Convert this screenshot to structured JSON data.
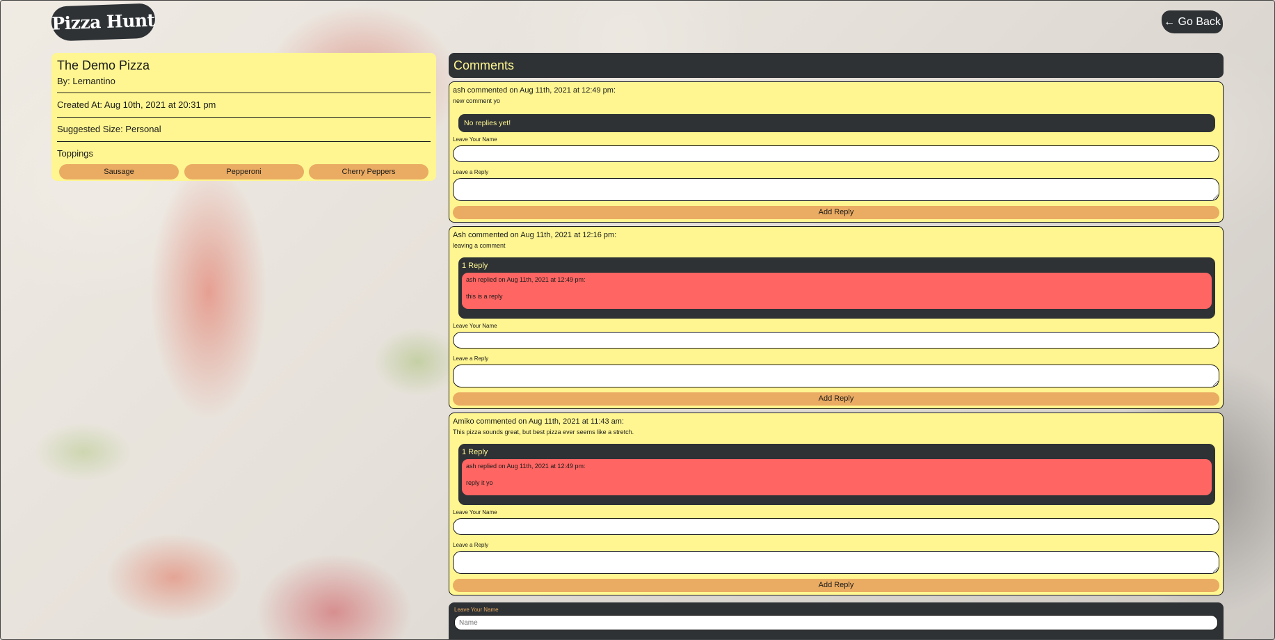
{
  "app": {
    "logo": "Pizza Hunt",
    "back_button": "← Go Back"
  },
  "pizza": {
    "name": "The Demo Pizza",
    "by": "By: Lernantino",
    "created": "Created At: Aug 10th, 2021 at 20:31 pm",
    "size": "Suggested Size: Personal",
    "toppings_label": "Toppings",
    "toppings": [
      "Sausage",
      "Pepperoni",
      "Cherry Peppers"
    ]
  },
  "comments": {
    "header": "Comments",
    "items": [
      {
        "head": "ash commented on Aug 11th, 2021 at 12:49 pm:",
        "body": "new comment yo",
        "no_replies": "No replies yet!"
      },
      {
        "head": "Ash commented on Aug 11th, 2021 at 12:16 pm:",
        "body": "leaving a comment",
        "replies_count": "1 Reply",
        "reply": {
          "head": "ash replied on Aug 11th, 2021 at 12:49 pm:",
          "body": "this is a reply"
        }
      },
      {
        "head": "Amiko commented on Aug 11th, 2021 at 11:43 am:",
        "body": "This pizza sounds great, but best pizza ever seems like a stretch.",
        "replies_count": "1 Reply",
        "reply": {
          "head": "ash replied on Aug 11th, 2021 at 12:49 pm:",
          "body": "reply it yo"
        }
      }
    ],
    "name_label": "Leave Your Name",
    "reply_label": "Leave a Reply",
    "add_reply": "Add Reply"
  },
  "new_comment": {
    "name_label": "Leave Your Name",
    "name_placeholder": "Name"
  }
}
